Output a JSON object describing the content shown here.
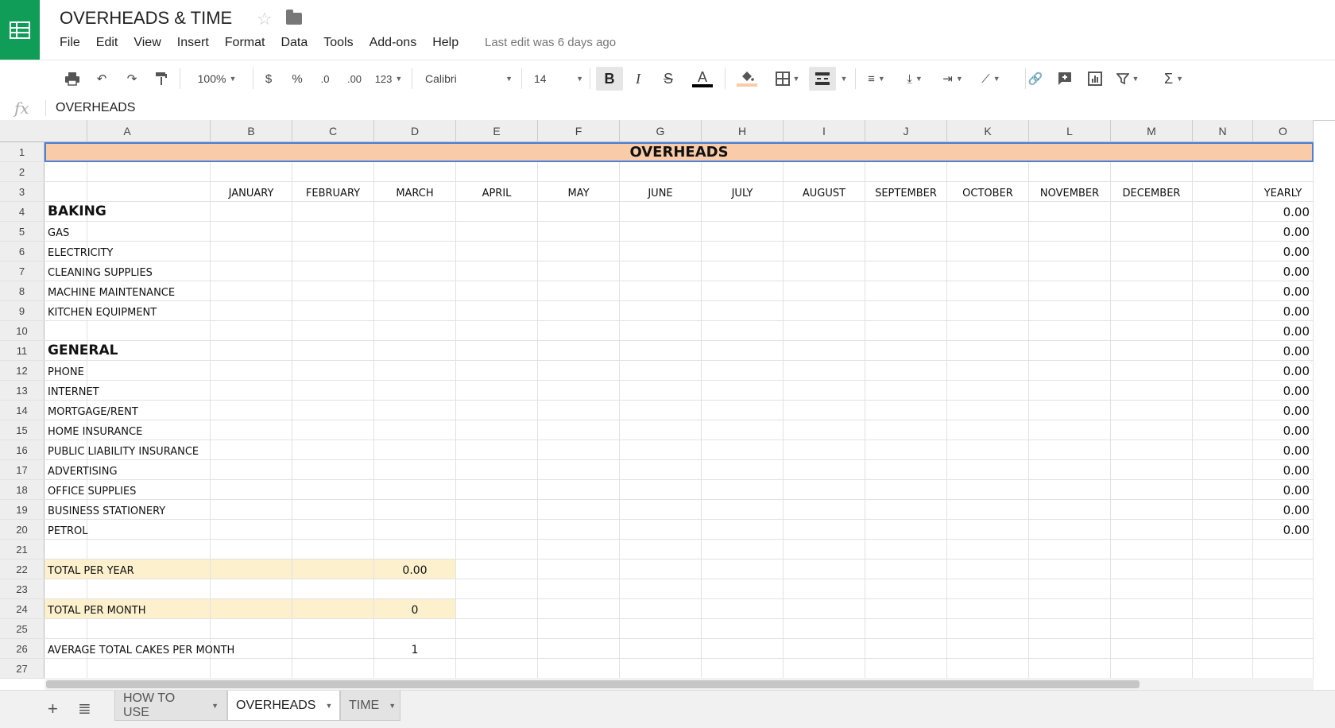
{
  "app": {
    "title": "OVERHEADS & TIME",
    "last_edit": "Last edit was 6 days ago",
    "menu": [
      "File",
      "Edit",
      "View",
      "Insert",
      "Format",
      "Data",
      "Tools",
      "Add-ons",
      "Help"
    ]
  },
  "toolbar": {
    "zoom": "100%",
    "currency": "$",
    "percent": "%",
    "dec_less": ".0",
    "dec_more": ".00",
    "more_formats": "123",
    "font": "Calibri",
    "font_size": "14",
    "bold": "B",
    "italic": "I",
    "strike": "S",
    "text_color": "A",
    "sum": "Σ"
  },
  "formula_bar": {
    "fx": "fx",
    "value": "OVERHEADS"
  },
  "columns": [
    "A",
    "B",
    "C",
    "D",
    "E",
    "F",
    "G",
    "H",
    "I",
    "J",
    "K",
    "L",
    "M",
    "N",
    "O"
  ],
  "rows": [
    "1",
    "2",
    "3",
    "4",
    "5",
    "6",
    "7",
    "8",
    "9",
    "10",
    "11",
    "12",
    "13",
    "14",
    "15",
    "16",
    "17",
    "18",
    "19",
    "20",
    "21",
    "22",
    "23",
    "24",
    "25",
    "26",
    "27"
  ],
  "sheet": {
    "banner": "OVERHEADS",
    "months": [
      "JANUARY",
      "FEBRUARY",
      "MARCH",
      "APRIL",
      "MAY",
      "JUNE",
      "JULY",
      "AUGUST",
      "SEPTEMBER",
      "OCTOBER",
      "NOVEMBER",
      "DECEMBER"
    ],
    "yearly_header": "YEARLY",
    "labels": {
      "r4": "BAKING",
      "r5": "GAS",
      "r6": "ELECTRICITY",
      "r7": "CLEANING SUPPLIES",
      "r8": "MACHINE MAINTENANCE",
      "r9": "KITCHEN EQUIPMENT",
      "r11": "GENERAL",
      "r12": "PHONE",
      "r13": "INTERNET",
      "r14": "MORTGAGE/RENT",
      "r15": "HOME INSURANCE",
      "r16": "PUBLIC LIABILITY INSURANCE",
      "r17": "ADVERTISING",
      "r18": "OFFICE SUPPLIES",
      "r19": "BUSINESS STATIONERY",
      "r20": "PETROL",
      "r22": "TOTAL PER YEAR",
      "r24": "TOTAL PER MONTH",
      "r26": "AVERAGE TOTAL CAKES PER MONTH"
    },
    "yearly_value": "0.00",
    "total_year": "0.00",
    "total_month": "0",
    "avg_cakes": "1"
  },
  "tabs": [
    "HOW TO USE",
    "OVERHEADS",
    "TIME"
  ],
  "active_tab": "OVERHEADS"
}
